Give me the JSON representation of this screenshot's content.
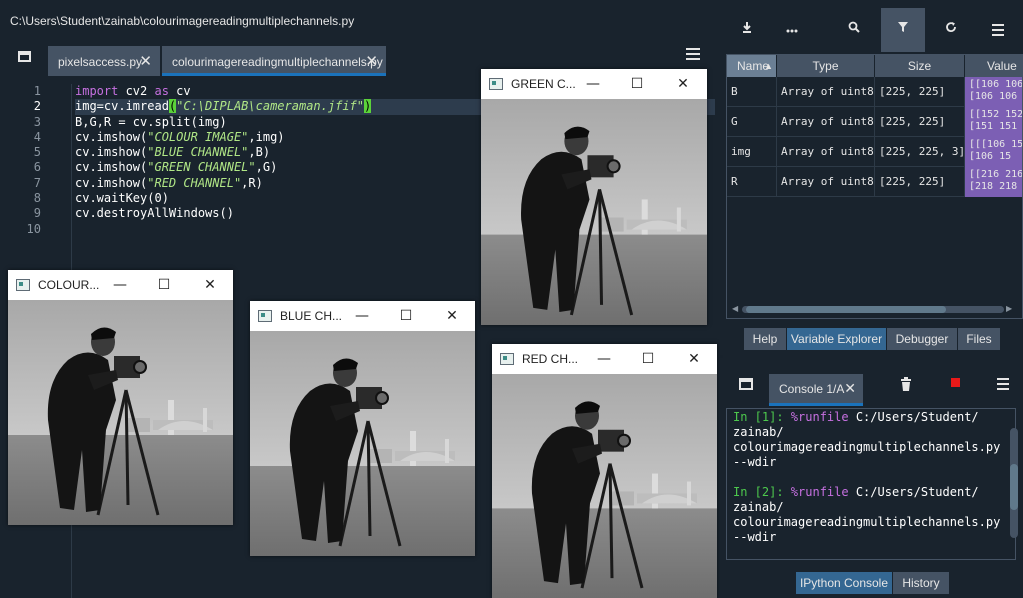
{
  "window": {
    "file_path": "C:\\Users\\Student\\zainab\\colourimagereadingmultiplechannels.py"
  },
  "editor": {
    "tabs": [
      {
        "label": "pixelsaccess.py",
        "close": "✕"
      },
      {
        "label": "colourimagereadingmultiplechannels.py",
        "close": "✕"
      }
    ],
    "active_tab": 1,
    "active_line": 2,
    "line_numbers": [
      "1",
      "2",
      "3",
      "4",
      "5",
      "6",
      "7",
      "8",
      "9",
      "10"
    ],
    "lines": [
      [
        {
          "t": "import",
          "c": "kw"
        },
        {
          "t": " cv2 ",
          "c": ""
        },
        {
          "t": "as",
          "c": "kw"
        },
        {
          "t": " cv",
          "c": ""
        }
      ],
      [
        {
          "t": "img=cv.imread",
          "c": ""
        },
        {
          "t": "(",
          "c": "pg"
        },
        {
          "t": "\"C:\\DIPLAB\\cameraman.jfif\"",
          "c": "str"
        },
        {
          "t": ")",
          "c": "pg"
        }
      ],
      [
        {
          "t": "B,G,R = cv.split(img)",
          "c": ""
        }
      ],
      [
        {
          "t": "cv.imshow(",
          "c": ""
        },
        {
          "t": "\"COLOUR IMAGE\"",
          "c": "str"
        },
        {
          "t": ",img)",
          "c": ""
        }
      ],
      [
        {
          "t": "cv.imshow(",
          "c": ""
        },
        {
          "t": "\"BLUE CHANNEL\"",
          "c": "str"
        },
        {
          "t": ",B)",
          "c": ""
        }
      ],
      [
        {
          "t": "cv.imshow(",
          "c": ""
        },
        {
          "t": "\"GREEN CHANNEL\"",
          "c": "str"
        },
        {
          "t": ",G)",
          "c": ""
        }
      ],
      [
        {
          "t": "cv.imshow(",
          "c": ""
        },
        {
          "t": "\"RED CHANNEL\"",
          "c": "str"
        },
        {
          "t": ",R)",
          "c": ""
        }
      ],
      [
        {
          "t": "cv.waitKey(",
          "c": ""
        },
        {
          "t": "0",
          "c": ""
        },
        {
          "t": ")",
          "c": ""
        }
      ],
      [
        {
          "t": "cv.destroyAllWindows()",
          "c": ""
        }
      ],
      []
    ]
  },
  "image_windows": [
    {
      "id": "green",
      "title": "GREEN C..."
    },
    {
      "id": "colour",
      "title": "COLOUR..."
    },
    {
      "id": "blue",
      "title": "BLUE CH..."
    },
    {
      "id": "red",
      "title": "RED CH..."
    }
  ],
  "window_buttons": {
    "minimize": "—",
    "maximize": "☐",
    "close": "✕"
  },
  "variable_explorer": {
    "toolbar_icons": [
      "download-icon",
      "more-icon",
      "search-icon",
      "filter-icon",
      "refresh-icon",
      "menu-icon"
    ],
    "headers": {
      "name": "Name",
      "type": "Type",
      "size": "Size",
      "value": "Value"
    },
    "rows": [
      {
        "name": "B",
        "type": "Array of uint8",
        "size": "[225, 225]",
        "value1": "[[106 106",
        "value2": " [106 106"
      },
      {
        "name": "G",
        "type": "Array of uint8",
        "size": "[225, 225]",
        "value1": "[[152 152",
        "value2": " [151 151"
      },
      {
        "name": "img",
        "type": "Array of uint8",
        "size": "[225, 225, 3]",
        "value1": "[[[106 15",
        "value2": "  [106 15"
      },
      {
        "name": "R",
        "type": "Array of uint8",
        "size": "[225, 225]",
        "value1": "[[216 216",
        "value2": " [218 218"
      }
    ],
    "bottom_tabs": [
      "Help",
      "Variable Explorer",
      "Debugger",
      "Files"
    ],
    "active_bottom_tab": 1
  },
  "console": {
    "tab_label": "Console 1/A",
    "close": "✕",
    "lines": [
      {
        "prompt": "In [1]: ",
        "magic": "%runfile",
        "rest": " C:/Users/Student/"
      },
      {
        "text": "zainab/"
      },
      {
        "text": "colourimagereadingmultiplechannels.py"
      },
      {
        "text": "--wdir"
      },
      {
        "text": ""
      },
      {
        "prompt": "In [2]: ",
        "magic": "%runfile",
        "rest": " C:/Users/Student/"
      },
      {
        "text": "zainab/"
      },
      {
        "text": "colourimagereadingmultiplechannels.py"
      },
      {
        "text": "--wdir"
      }
    ],
    "bottom_tabs": [
      "IPython Console",
      "History"
    ],
    "active_bottom_tab": 0
  },
  "colors": {
    "background": "#19232d",
    "panel": "#455364",
    "accent": "#1a72bb",
    "keyword": "#c670e0",
    "string": "#b0e686",
    "prompt": "#4dc94d",
    "stop": "#e81919"
  }
}
